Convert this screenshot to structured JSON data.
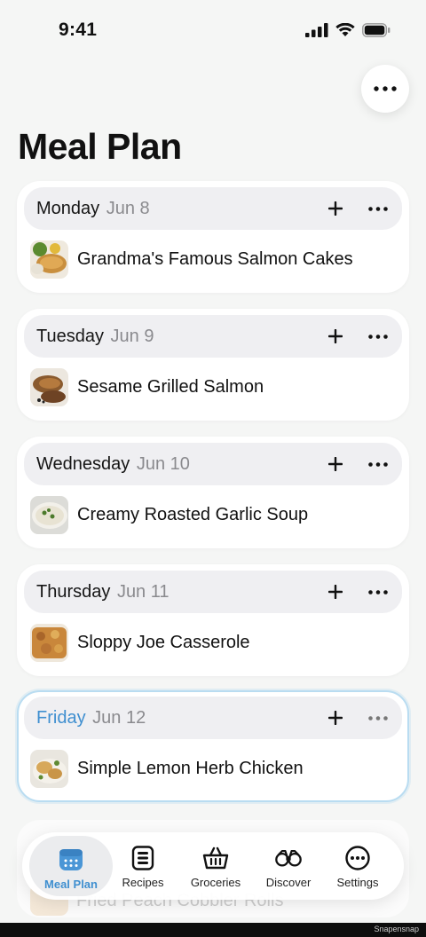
{
  "status_bar": {
    "time": "9:41"
  },
  "page": {
    "title": "Meal Plan"
  },
  "days": [
    {
      "weekday": "Monday",
      "date": "Jun 8",
      "meal": "Grandma's Famous Salmon Cakes"
    },
    {
      "weekday": "Tuesday",
      "date": "Jun 9",
      "meal": "Sesame Grilled Salmon"
    },
    {
      "weekday": "Wednesday",
      "date": "Jun 10",
      "meal": "Creamy Roasted Garlic Soup"
    },
    {
      "weekday": "Thursday",
      "date": "Jun 11",
      "meal": "Sloppy Joe Casserole"
    },
    {
      "weekday": "Friday",
      "date": "Jun 12",
      "meal": "Simple Lemon Herb Chicken"
    }
  ],
  "partial_next_meal": "Fried Peach Cobbler Rolls",
  "tabs": [
    {
      "label": "Meal Plan",
      "icon": "calendar-icon",
      "active": true
    },
    {
      "label": "Recipes",
      "icon": "recipe-book-icon"
    },
    {
      "label": "Groceries",
      "icon": "basket-icon"
    },
    {
      "label": "Discover",
      "icon": "binoculars-icon"
    },
    {
      "label": "Settings",
      "icon": "ellipsis-circle-icon"
    }
  ],
  "watermark": "Snapensnap",
  "colors": {
    "accent": "#3f8fd0",
    "today_border": "#b9dcf1",
    "header_bg": "#efeff2"
  }
}
